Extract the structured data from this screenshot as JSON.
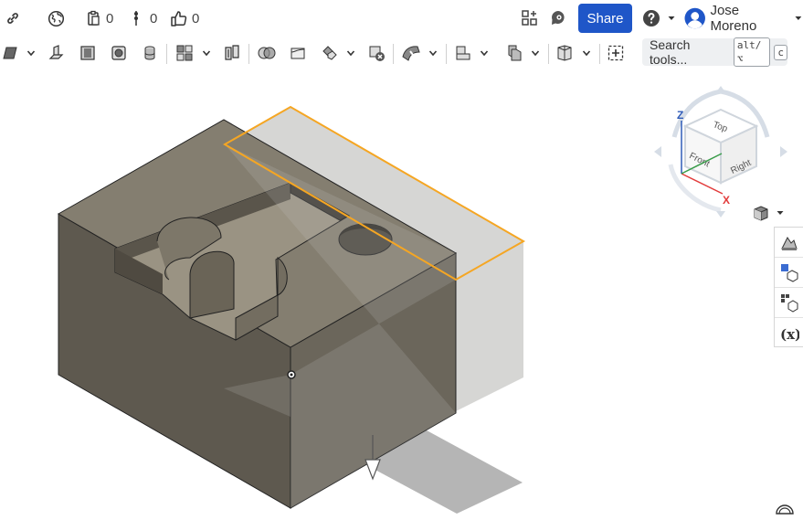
{
  "topbar": {
    "likes_count": "0",
    "branches_count": "0",
    "versions_count": "0",
    "share_label": "Share",
    "user_name": "Jose Moreno"
  },
  "search": {
    "label": "Search tools...",
    "shortcut_1": "alt/⌥",
    "shortcut_2": "c"
  },
  "view_cube": {
    "top": "Top",
    "front": "Front",
    "right": "Right",
    "axis_z": "Z",
    "axis_x": "X"
  },
  "colors": {
    "accent": "#1f56c8",
    "part_top": "#817a6c",
    "part_front": "#5f5a50",
    "part_side": "#706a5f",
    "plane_fill": "#d6d6d4",
    "selection": "#f5a623"
  }
}
